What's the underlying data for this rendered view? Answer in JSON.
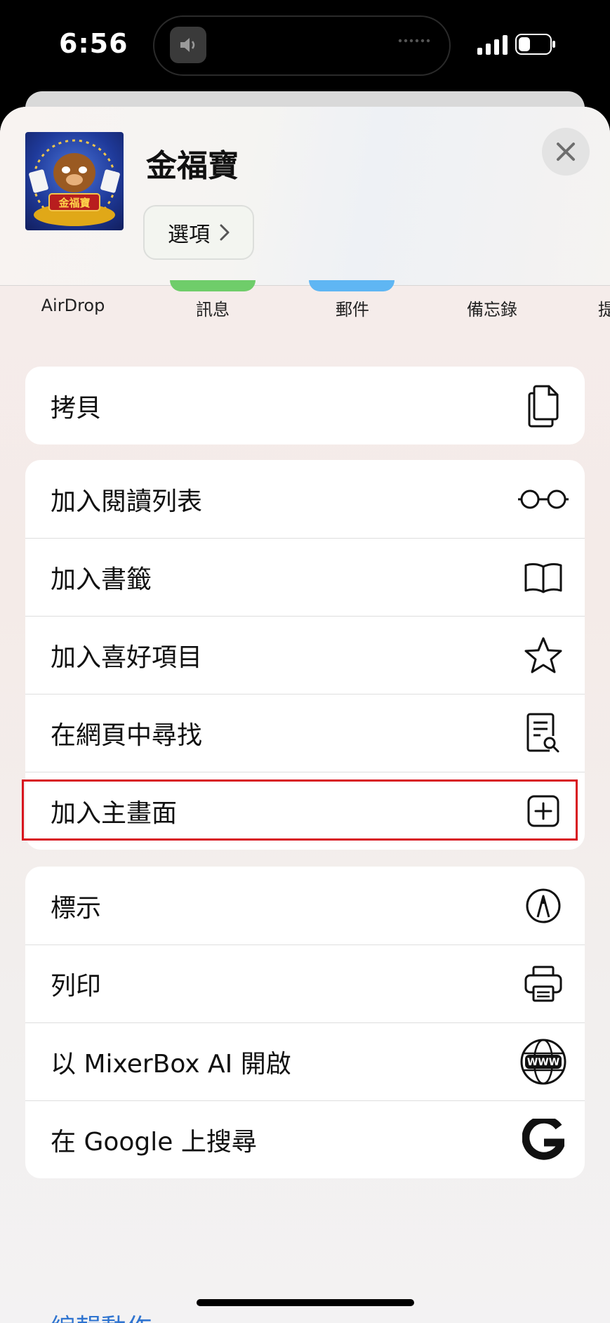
{
  "status_bar": {
    "time": "6:56"
  },
  "share_sheet": {
    "title": "金福寶",
    "thumbnail_text": "金福寶",
    "options_label": "選項",
    "options_chevron": "›",
    "apps": [
      "AirDrop",
      "訊息",
      "郵件",
      "備忘錄",
      "提"
    ],
    "copy_group": [
      {
        "label": "拷貝",
        "icon": "copy-icon"
      }
    ],
    "actions_group": [
      {
        "label": "加入閱讀列表",
        "icon": "glasses-icon"
      },
      {
        "label": "加入書籤",
        "icon": "book-icon"
      },
      {
        "label": "加入喜好項目",
        "icon": "star-icon"
      },
      {
        "label": "在網頁中尋找",
        "icon": "find-in-page-icon"
      },
      {
        "label": "加入主畫面",
        "icon": "add-square-icon"
      }
    ],
    "tools_group": [
      {
        "label": "標示",
        "icon": "markup-icon"
      },
      {
        "label": "列印",
        "icon": "printer-icon"
      },
      {
        "label": "以 MixerBox AI 開啟",
        "icon": "www-globe-icon"
      },
      {
        "label": "在 Google 上搜尋",
        "icon": "google-icon"
      }
    ],
    "edit_actions": "編輯動作⋯",
    "highlight_color": "#d8141e",
    "link_color": "#2f74d0"
  }
}
